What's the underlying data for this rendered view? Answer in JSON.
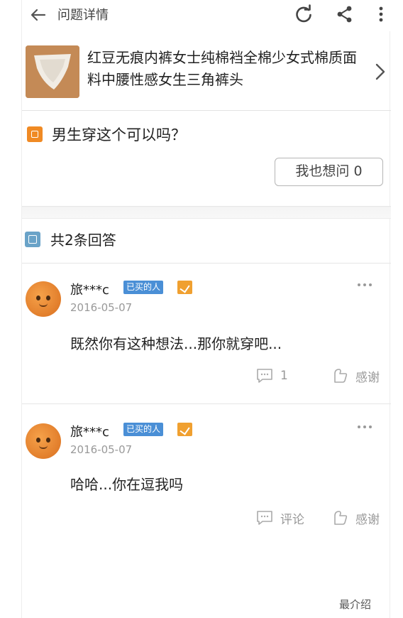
{
  "topbar": {
    "title": "问题详情",
    "icons": [
      "back-arrow-icon",
      "refresh-icon",
      "share-icon",
      "more-vertical-icon"
    ]
  },
  "product": {
    "name": "红豆无痕内裤女士纯棉裆全棉少女式棉质面料中腰性感女生三角裤头"
  },
  "question": {
    "text": "男生穿这个可以吗？",
    "ask_button": "我也想问 0"
  },
  "answers_header": "共2条回答",
  "answers": [
    {
      "username": "旅***c",
      "badge": "已买的人",
      "date": "2016-05-07",
      "content": "既然你有这种想法...那你就穿吧...",
      "comment_label": "1",
      "thanks_label": "感谢"
    },
    {
      "username": "旅***c",
      "badge": "已买的人",
      "date": "2016-05-07",
      "content": "哈哈...你在逗我吗",
      "comment_label": "评论",
      "thanks_label": "感谢"
    }
  ],
  "watermark": "最介绍"
}
